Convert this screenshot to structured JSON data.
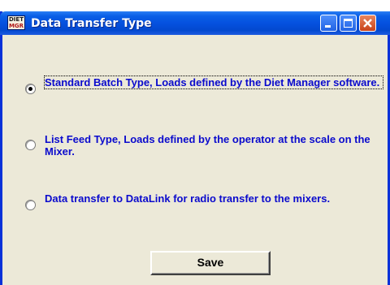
{
  "window": {
    "title": "Data Transfer Type",
    "app_icon_text_line1": "DIET",
    "app_icon_text_line2": "MGR"
  },
  "options": [
    {
      "label": "Standard Batch Type, Loads defined by the Diet Manager software.",
      "selected": true
    },
    {
      "label": "List Feed Type, Loads defined by the operator at the scale on the Mixer.",
      "selected": false
    },
    {
      "label": "Data transfer to DataLink for radio transfer to the mixers.",
      "selected": false
    }
  ],
  "buttons": {
    "save_label": "Save"
  },
  "colors": {
    "label_text": "#0a0acd",
    "window_face": "#ece9d8",
    "titlebar": "#0551df",
    "close_button": "#c9421a"
  },
  "icons": {
    "app": "diet-manager-app-icon",
    "minimize": "minimize-icon",
    "maximize": "maximize-icon",
    "close": "close-icon"
  }
}
